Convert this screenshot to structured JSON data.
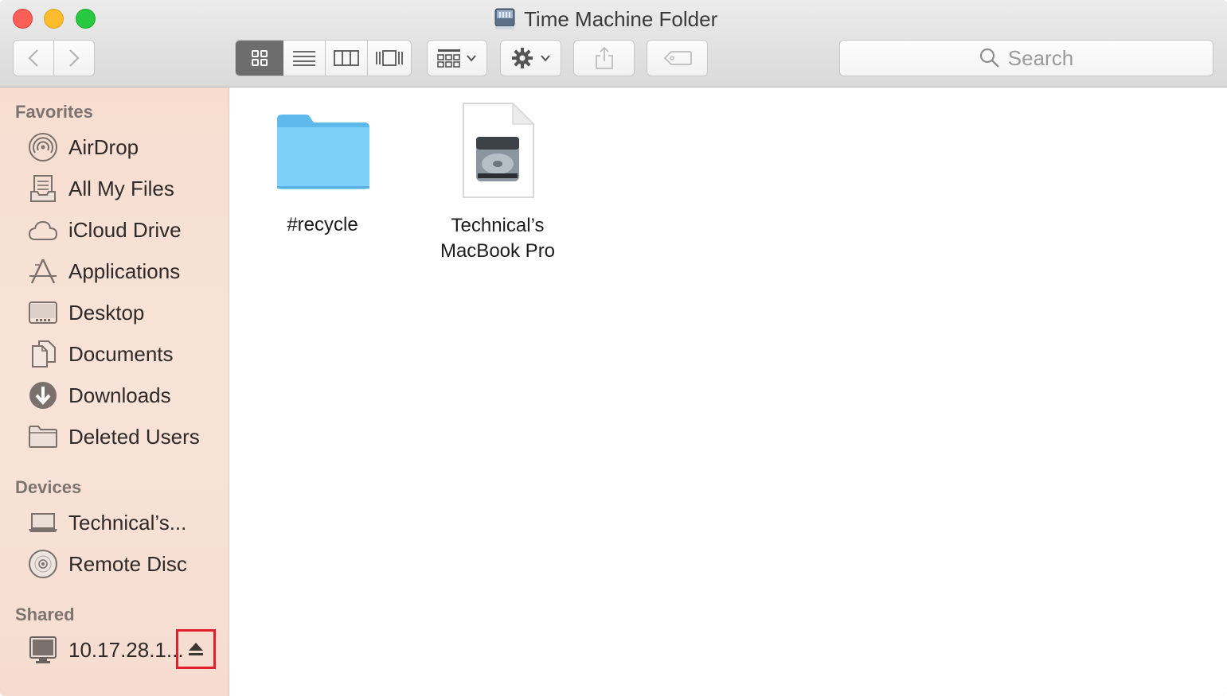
{
  "window": {
    "title": "Time Machine Folder"
  },
  "toolbar": {
    "search_placeholder": "Search"
  },
  "sidebar": {
    "favorites_header": "Favorites",
    "favorites": [
      {
        "label": "AirDrop",
        "icon": "airdrop-icon"
      },
      {
        "label": "All My Files",
        "icon": "all-files-icon"
      },
      {
        "label": "iCloud Drive",
        "icon": "cloud-icon"
      },
      {
        "label": "Applications",
        "icon": "applications-icon"
      },
      {
        "label": "Desktop",
        "icon": "desktop-icon"
      },
      {
        "label": "Documents",
        "icon": "documents-icon"
      },
      {
        "label": "Downloads",
        "icon": "downloads-icon"
      },
      {
        "label": "Deleted Users",
        "icon": "folder-icon"
      }
    ],
    "devices_header": "Devices",
    "devices": [
      {
        "label": "Technical’s...",
        "icon": "laptop-icon"
      },
      {
        "label": "Remote Disc",
        "icon": "disc-icon"
      }
    ],
    "shared_header": "Shared",
    "shared": [
      {
        "label": "10.17.28.1...",
        "icon": "monitor-icon"
      }
    ]
  },
  "files": [
    {
      "name": "#recycle",
      "icon": "folder-icon"
    },
    {
      "name_line1": "Technical’s",
      "name_line2": "MacBook Pro",
      "icon": "hard-drive-icon"
    }
  ]
}
